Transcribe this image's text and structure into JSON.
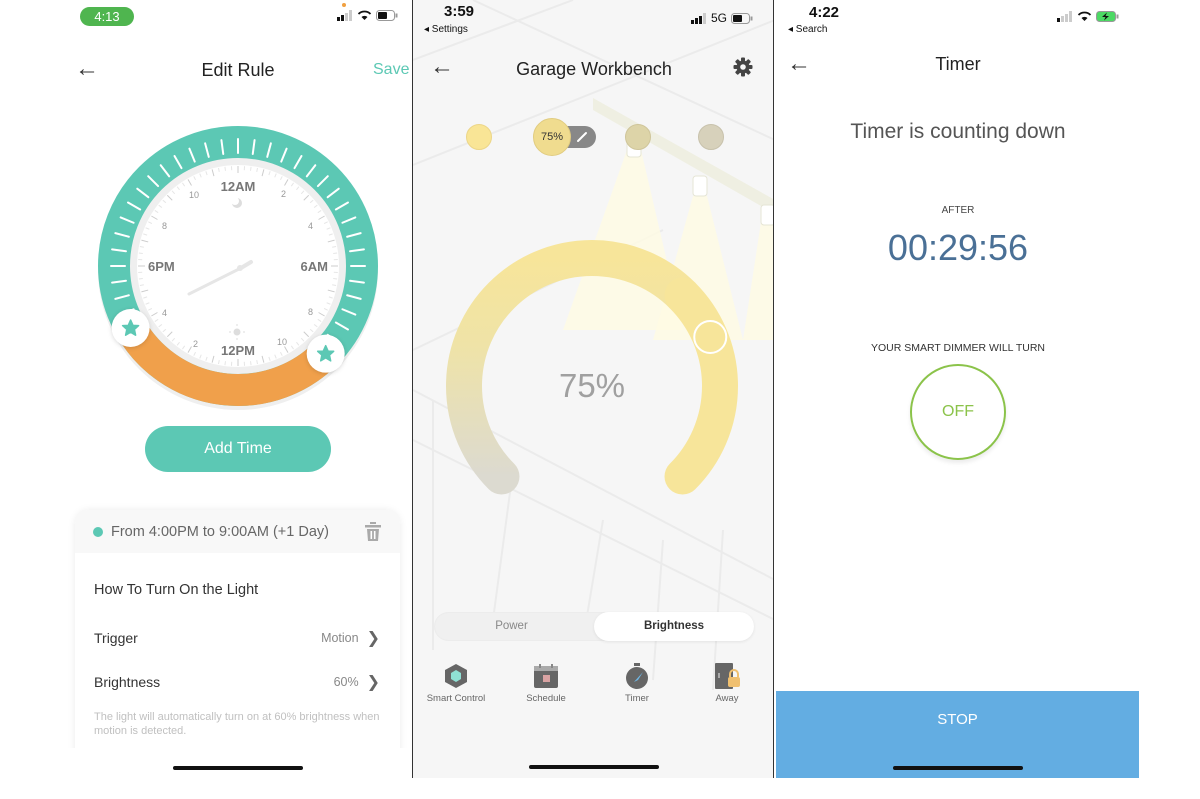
{
  "screen1": {
    "status_time": "4:13",
    "nav": {
      "title": "Edit Rule",
      "save_label": "Save"
    },
    "clock": {
      "major_labels": {
        "top": "12AM",
        "right": "6AM",
        "bottom": "12PM",
        "left": "6PM"
      },
      "minor_labels": [
        "2",
        "4",
        "8",
        "10",
        "2",
        "4",
        "8",
        "10"
      ],
      "range_start": "4:00PM",
      "range_end": "9:00AM",
      "colors": {
        "track": "#5cc8b4",
        "selected": "#f0a04b"
      }
    },
    "add_time_label": "Add Time",
    "rule": {
      "range_text": "From 4:00PM to 9:00AM (+1 Day)",
      "section_title": "How To Turn On the Light",
      "trigger_label": "Trigger",
      "trigger_value": "Motion",
      "brightness_label": "Brightness",
      "brightness_value": "60%",
      "hint": "The light will automatically turn on at 60% brightness when motion is detected."
    }
  },
  "screen2": {
    "status_time": "3:59",
    "back_app": "◂ Settings",
    "network": "5G",
    "nav": {
      "title": "Garage Workbench"
    },
    "selected_bulb_label": "75%",
    "dial": {
      "value_label": "75%",
      "value": 75,
      "colors": {
        "start": "#dcdad0",
        "end": "#f7e59a"
      }
    },
    "segments": {
      "power": "Power",
      "brightness": "Brightness",
      "active": "brightness"
    },
    "functions": [
      {
        "label": "Smart Control",
        "icon": "smart-control-icon"
      },
      {
        "label": "Schedule",
        "icon": "schedule-icon"
      },
      {
        "label": "Timer",
        "icon": "timer-icon"
      },
      {
        "label": "Away",
        "icon": "away-icon"
      }
    ]
  },
  "screen3": {
    "status_time": "4:22",
    "back_app": "◂ Search",
    "nav": {
      "title": "Timer"
    },
    "heading": "Timer is counting down",
    "after_label": "AFTER",
    "countdown": "00:29:56",
    "will_turn_label": "YOUR SMART DIMMER WILL TURN",
    "target_state": "OFF",
    "stop_label": "STOP",
    "colors": {
      "countdown": "#4a7096",
      "off": "#8bc34a",
      "stop": "#63ade2"
    }
  }
}
